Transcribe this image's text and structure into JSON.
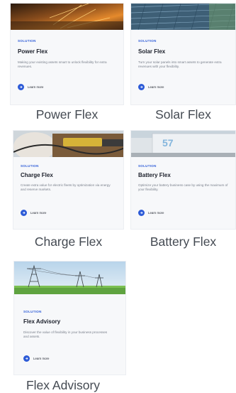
{
  "cards": [
    {
      "tag": "SOLUTION",
      "title": "Power Flex",
      "desc": "Making your existing assets smart to unlock flexibility for extra revenues.",
      "link": "Learn more",
      "caption": "Power Flex"
    },
    {
      "tag": "SOLUTION",
      "title": "Solar Flex",
      "desc": "Turn your solar panels into smart assets to generate extra revenues with your flexibility.",
      "link": "Learn more",
      "caption": "Solar Flex"
    },
    {
      "tag": "SOLUTION",
      "title": "Charge Flex",
      "desc": "Create extra value for electric fleets by optimization via energy and reserve markets.",
      "link": "Learn more",
      "caption": "Charge Flex"
    },
    {
      "tag": "SOLUTION",
      "title": "Battery Flex",
      "desc": "Optimize your battery business case by using the maximum of your flexibility.",
      "link": "Learn more",
      "caption": "Battery Flex"
    },
    {
      "tag": "SOLUTION",
      "title": "Flex Advisory",
      "desc": "Discover the value of flexibility in your business processes and assets.",
      "link": "Learn more",
      "caption": "Flex Advisory"
    }
  ],
  "colors": {
    "accent": "#2d5bd7",
    "card_bg": "#f7f8fa"
  },
  "icons": {
    "learn_more": "arrow-right-icon"
  }
}
